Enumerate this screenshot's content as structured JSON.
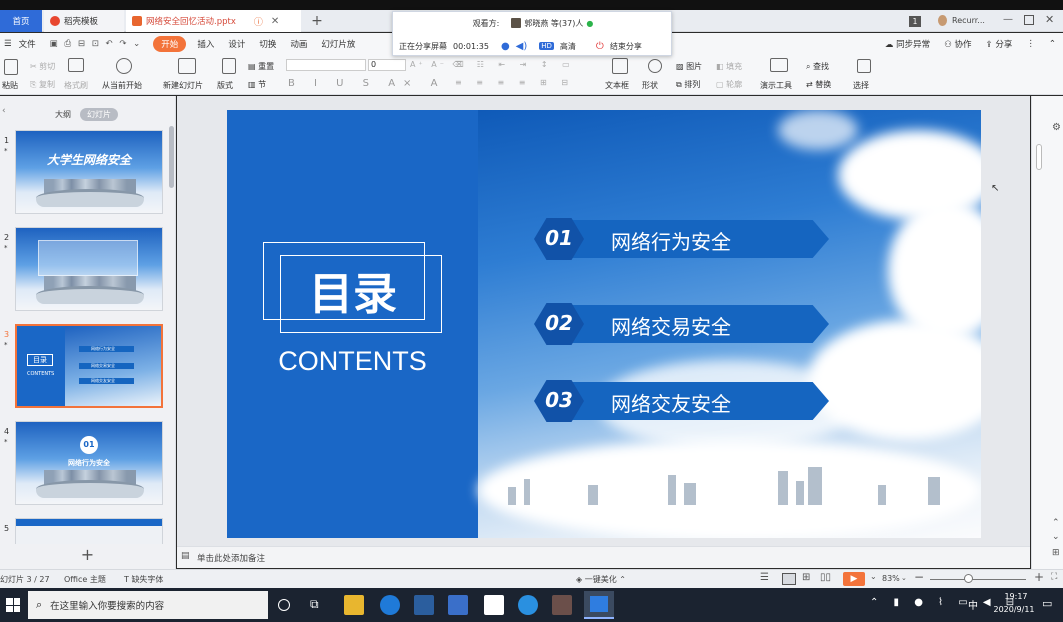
{
  "tabs": {
    "home": "首页",
    "daoke": "稻壳模板",
    "file": "网络安全回忆活动.pptx"
  },
  "share": {
    "viewer_label": "观看方:",
    "viewer_name": "郭晓燕 等(37)人",
    "sharing_text": "正在分享屏幕",
    "timer": "00:01:35",
    "hd_badge": "HD",
    "quality_label": "高清",
    "end_label": "结束分享"
  },
  "menu": {
    "file": "文件",
    "items": [
      "开始",
      "插入",
      "设计",
      "切换",
      "动画",
      "幻灯片放"
    ],
    "right": [
      "同步异常",
      "协作",
      "分享"
    ]
  },
  "topright": {
    "badge": "1",
    "account": "Recurr..."
  },
  "ribbon": {
    "paste": "粘贴",
    "cut": "剪切",
    "copy": "复制",
    "format_brush": "格式刷",
    "play_from_current": "从当前开始",
    "new_slide": "新建幻灯片",
    "layout": "版式",
    "reset": "重置",
    "section": "节",
    "font_size": "0",
    "textbox": "文本框",
    "shape": "形状",
    "image": "图片",
    "arrange": "排列",
    "fill": "填充",
    "outline": "轮廓",
    "present_tool": "演示工具",
    "find": "查找",
    "replace": "替换",
    "select": "选择"
  },
  "leftpanel": {
    "tab_outline": "大纲",
    "tab_slides": "幻灯片",
    "thumbs": [
      {
        "num": "1",
        "title": "大学生网络安全"
      },
      {
        "num": "2",
        "title": ""
      },
      {
        "num": "3",
        "title": "目录"
      },
      {
        "num": "4",
        "title": "网络行为安全"
      },
      {
        "num": "5",
        "title": ""
      }
    ],
    "thumb3_contents": "CONTENTS",
    "thumb3_items": [
      "网络行为安全",
      "网络交易安全",
      "网络交友安全"
    ],
    "thumb4_num": "01",
    "add_label": "+"
  },
  "slide": {
    "title": "目录",
    "subtitle": "CONTENTS",
    "items": [
      {
        "num": "01",
        "label": "网络行为安全"
      },
      {
        "num": "02",
        "label": "网络交易安全"
      },
      {
        "num": "03",
        "label": "网络交友安全"
      }
    ]
  },
  "notes": {
    "placeholder": "单击此处添加备注"
  },
  "status": {
    "slide_counter": "幻灯片 3 / 27",
    "theme": "Office 主题",
    "missing_font": "缺失字体",
    "beautify": "一键美化",
    "zoom": "83%"
  },
  "taskbar": {
    "search_placeholder": "在这里输入你要搜索的内容",
    "ime": "中",
    "time": "19:17",
    "date": "2020/9/11"
  },
  "colors": {
    "slide_blue": "#1a67c6",
    "accent_orange": "#f3733a",
    "tab_blue": "#2f6bd8"
  }
}
